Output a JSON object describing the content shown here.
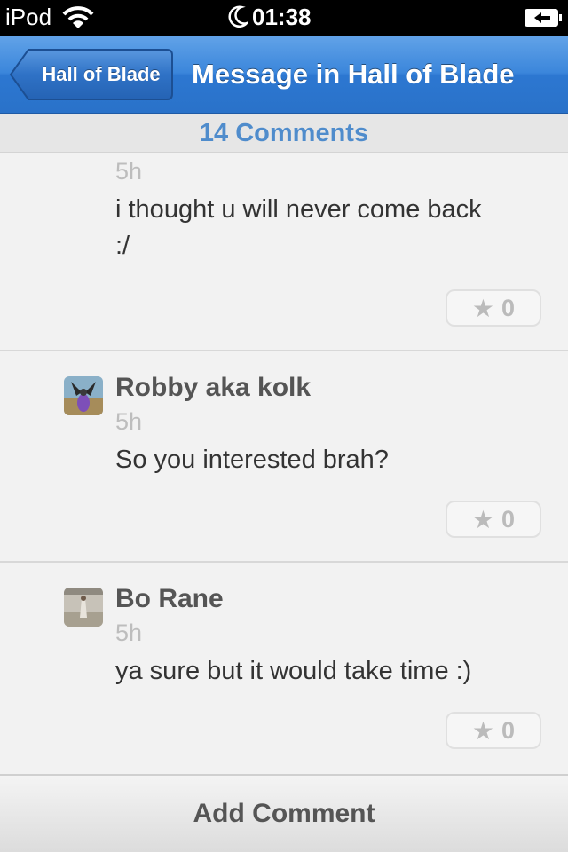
{
  "status_bar": {
    "carrier": "iPod",
    "time": "01:38"
  },
  "nav": {
    "back_label": "Hall of Blade",
    "title": "Message in Hall of Blade"
  },
  "comments_header": "14 Comments",
  "comments": [
    {
      "author": "",
      "time": "5h",
      "text": "i thought u will never come back :/",
      "likes": "0"
    },
    {
      "author": "Robby aka kolk",
      "time": "5h",
      "text": "So you interested brah?",
      "likes": "0"
    },
    {
      "author": "Bo Rane",
      "time": "5h",
      "text": "ya sure but it would take time :)",
      "likes": "0"
    }
  ],
  "like_star": "★",
  "bottom": {
    "add_comment_label": "Add Comment"
  },
  "colors": {
    "nav_blue": "#3b86db",
    "comments_header_text": "#4f8ccc"
  }
}
